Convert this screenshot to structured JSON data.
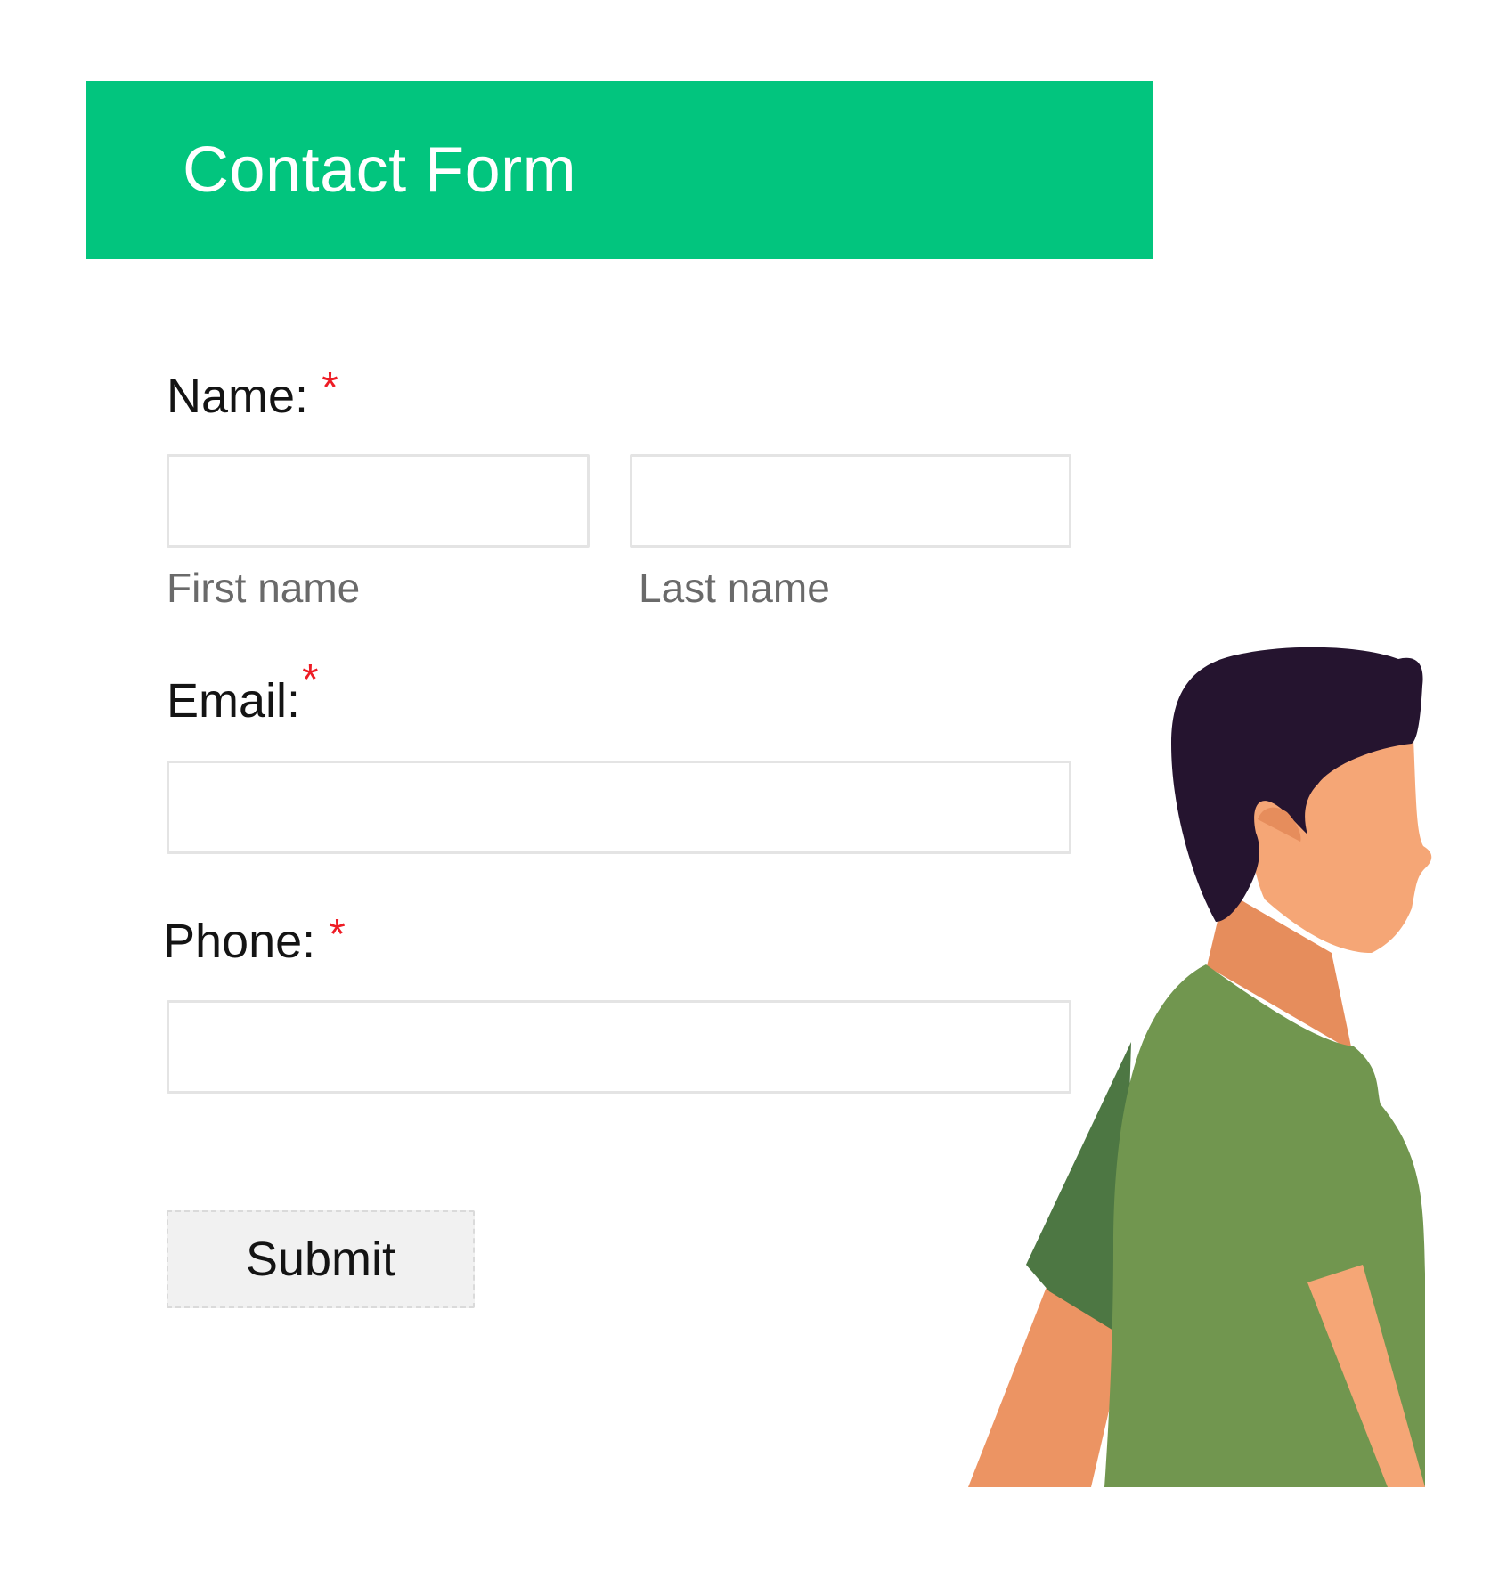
{
  "header": {
    "title": "Contact Form"
  },
  "form": {
    "name": {
      "label": "Name:",
      "required_mark": "*",
      "first": {
        "sublabel": "First name",
        "value": ""
      },
      "last": {
        "sublabel": "Last name",
        "value": ""
      }
    },
    "email": {
      "label": "Email:",
      "required_mark": "*",
      "value": ""
    },
    "phone": {
      "label": "Phone:",
      "required_mark": "*",
      "value": ""
    },
    "submit_label": "Submit"
  },
  "illustration": {
    "icon": "person-illustration-icon"
  },
  "colors": {
    "header_bg": "#02c57e",
    "required": "#ee1c25",
    "hair": "#25142f",
    "skin": "#f5a676",
    "shirt": "#71964f",
    "shirt_shadow": "#4d7743"
  }
}
